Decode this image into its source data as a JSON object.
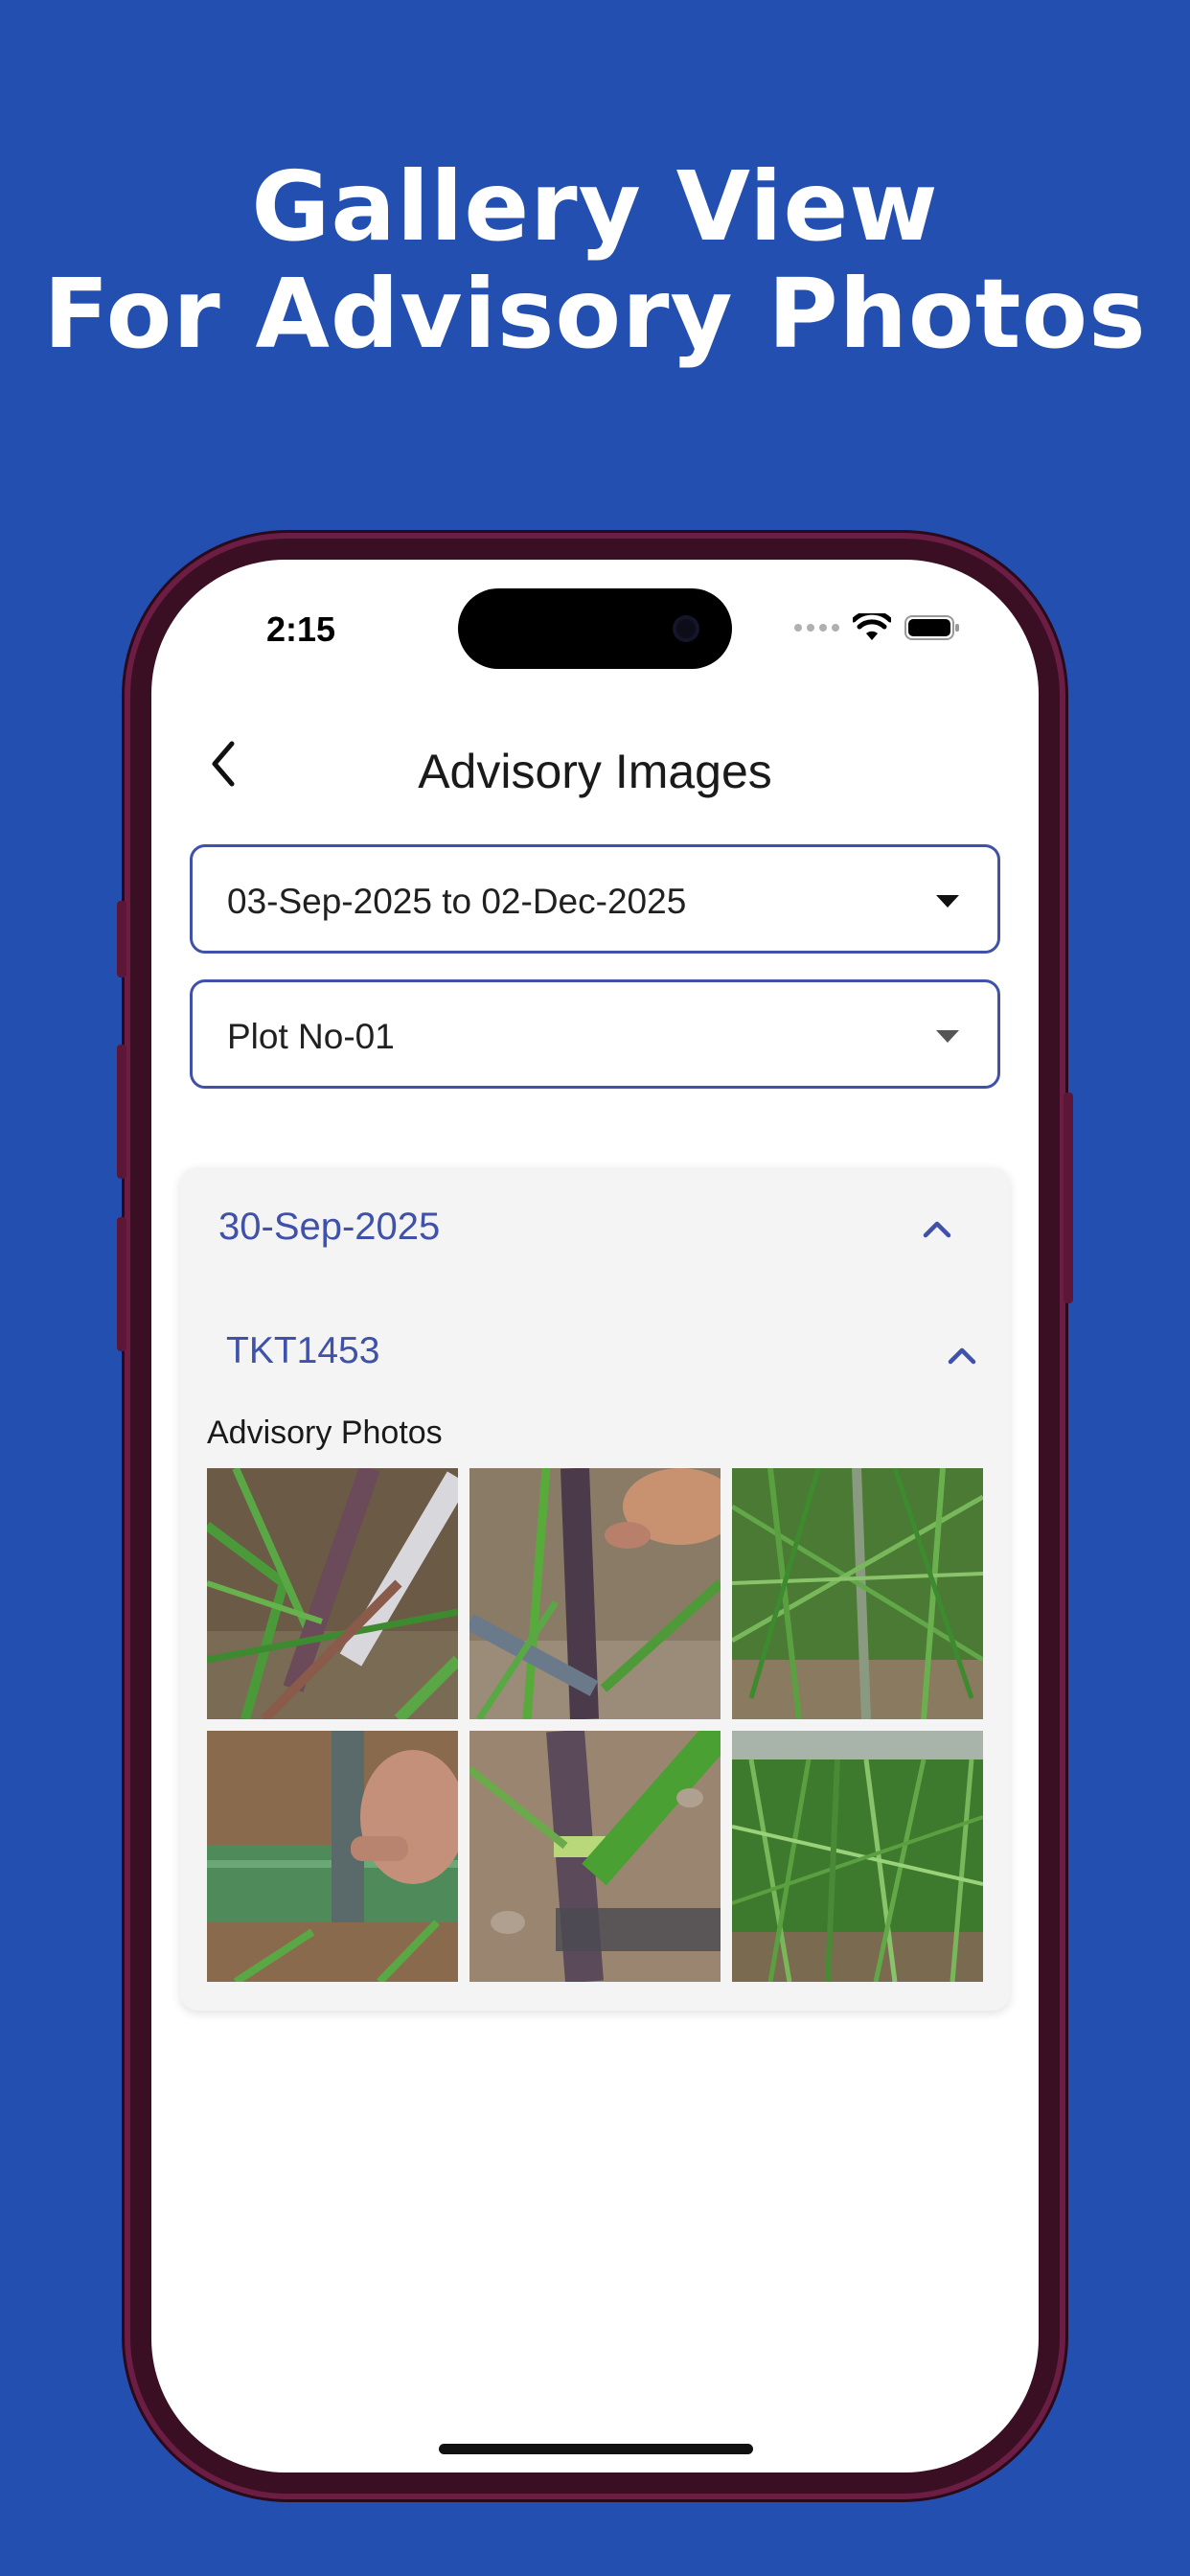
{
  "headline": {
    "line1": "Gallery View",
    "line2": "For Advisory Photos"
  },
  "status_bar": {
    "time": "2:15"
  },
  "nav": {
    "title": "Advisory Images",
    "back_icon": "chevron-left-icon"
  },
  "filters": {
    "date_range": {
      "value": "03-Sep-2025 to 02-Dec-2025"
    },
    "plot": {
      "value": "Plot No-01"
    }
  },
  "advisory_group": {
    "date": "30-Sep-2025",
    "ticket": "TKT1453",
    "photos_label": "Advisory Photos",
    "photos": [
      "sugarcane-stalk-with-ruler-photo",
      "hand-holding-cane-stalk-photo",
      "green-cane-field-photo",
      "cane-measured-with-tape-photo",
      "cane-node-closeup-photo",
      "dense-cane-field-photo"
    ]
  },
  "colors": {
    "background": "#2350b0",
    "accent": "#3f51a8",
    "card": "#f4f4f4"
  }
}
